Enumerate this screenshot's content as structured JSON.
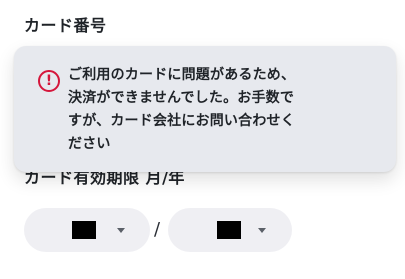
{
  "card_number": {
    "label": "カード番号"
  },
  "error": {
    "icon": "error-icon",
    "icon_glyph": "!",
    "message": "ご利用のカードに問題があるため、\n決済ができませんでした。お手数で\nすが、カード会社にお問い合わせく\nださい",
    "accent_color": "#d5163b"
  },
  "expiry": {
    "label": "カード有効期限 月/年",
    "separator": "/",
    "month": {
      "selected": ""
    },
    "year": {
      "selected": ""
    }
  },
  "colors": {
    "field_bg": "#efeff3",
    "toast_bg": "#e7e9ee",
    "text": "#1f2328"
  }
}
